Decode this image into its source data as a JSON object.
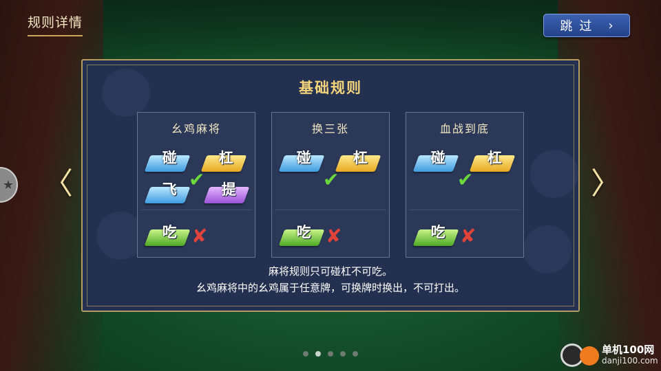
{
  "header": {
    "title": "规则详情",
    "skip_label": "跳过",
    "skip_icon": "chevron-right-icon"
  },
  "panel": {
    "title": "基础规则",
    "cards": [
      {
        "title": "幺鸡麻将",
        "tiles": [
          "碰",
          "杠",
          "飞",
          "提"
        ],
        "chi": "吃"
      },
      {
        "title": "换三张",
        "tiles": [
          "碰",
          "杠"
        ],
        "chi": "吃"
      },
      {
        "title": "血战到底",
        "tiles": [
          "碰",
          "杠"
        ],
        "chi": "吃"
      }
    ],
    "desc_line1": "麻将规则只可碰杠不可吃。",
    "desc_line2": "幺鸡麻将中的幺鸡属于任意牌，可换牌时换出，不可打出。"
  },
  "nav": {
    "prev_icon": "chevron-left-icon",
    "next_icon": "chevron-right-icon",
    "prev_glyph": "〈",
    "next_glyph": "〉"
  },
  "pagination": {
    "total": 5,
    "active_index": 1
  },
  "watermark": {
    "name": "单机100网",
    "url": "danji100.com"
  },
  "colors": {
    "accent_gold": "#f4d47a",
    "skip_blue": "#3c62b0",
    "panel_bg": "#243050",
    "check_green": "#6dd83c",
    "cross_red": "#e0433a"
  }
}
